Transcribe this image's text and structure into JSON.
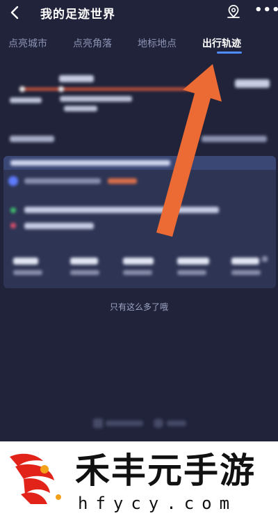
{
  "header": {
    "title": "我的足迹世界",
    "back_icon": "back-chevron-icon",
    "location_icon": "location-pin-icon",
    "more_label": "•••"
  },
  "tabs": [
    {
      "label": "点亮城市",
      "active": false
    },
    {
      "label": "点亮角落",
      "active": false
    },
    {
      "label": "地标地点",
      "active": false
    },
    {
      "label": "出行轨迹",
      "active": true
    }
  ],
  "colors": {
    "background": "#20233a",
    "accent": "#4f8dff",
    "arrow": "#ec6a34"
  },
  "list": {
    "end_note": "只有这么多了哦"
  },
  "watermark": {
    "brand_text": "禾丰元手游",
    "url": "hfycy.com"
  }
}
